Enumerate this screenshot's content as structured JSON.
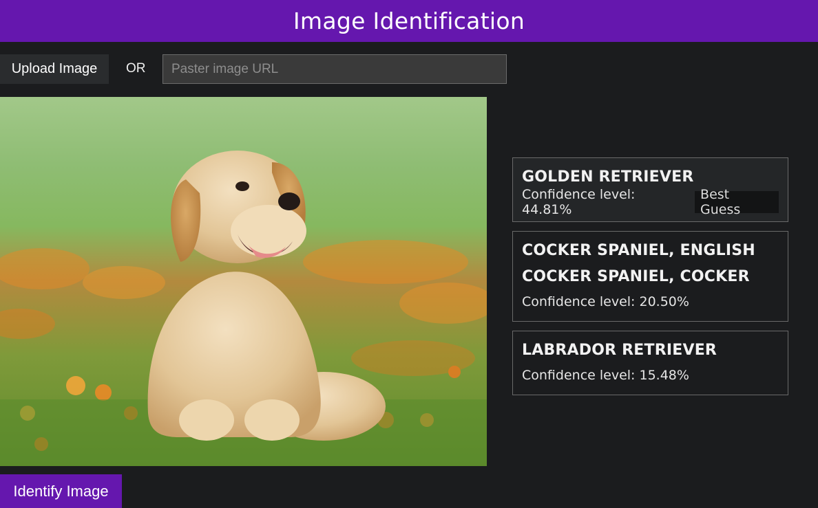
{
  "header": {
    "title": "Image Identification"
  },
  "controls": {
    "upload_label": "Upload Image",
    "or_label": "OR",
    "url_placeholder": "Paster image URL",
    "url_value": ""
  },
  "photo": {
    "subject": "golden retriever puppy sitting in grass with orange flowers"
  },
  "results": [
    {
      "names": [
        "GOLDEN RETRIEVER"
      ],
      "confidence": "Confidence level: 44.81%",
      "badge": "Best Guess"
    },
    {
      "names": [
        "COCKER SPANIEL, ENGLISH",
        "COCKER SPANIEL, COCKER"
      ],
      "confidence": "Confidence level: 20.50%"
    },
    {
      "names": [
        "LABRADOR RETRIEVER"
      ],
      "confidence": "Confidence level: 15.48%"
    }
  ],
  "actions": {
    "identify_label": "Identify Image"
  },
  "colors": {
    "accent": "#6517ae",
    "background": "#1b1c1e"
  }
}
